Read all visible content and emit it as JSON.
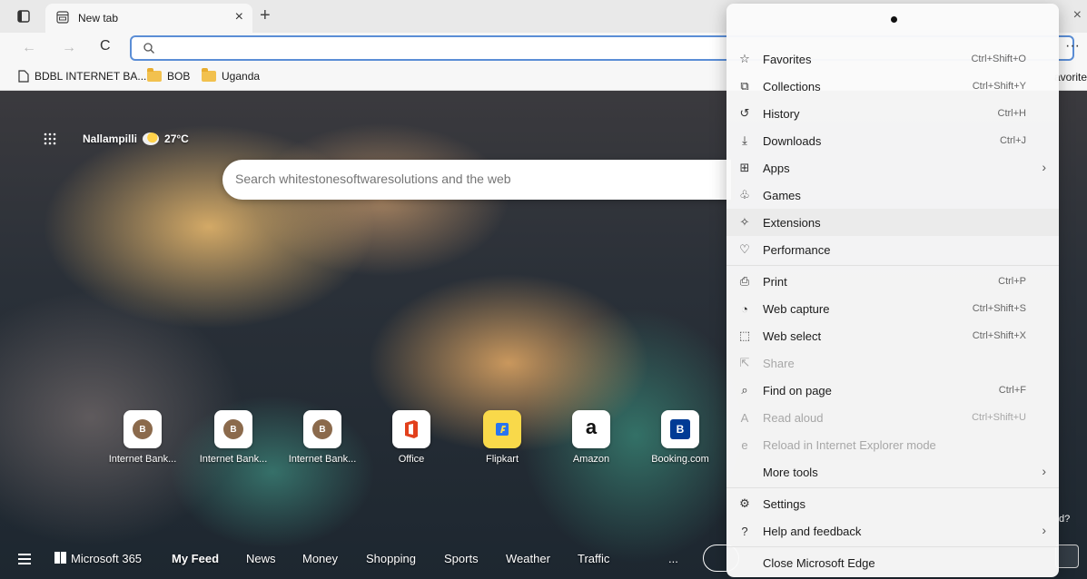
{
  "tab": {
    "title": "New tab",
    "close_glyph": "×"
  },
  "toolbar": {
    "address_value": "",
    "more_glyph": "···",
    "refresh_glyph": "C"
  },
  "bookmarks": [
    {
      "label": "BDBL INTERNET BA..."
    },
    {
      "label": "BOB"
    },
    {
      "label": "Uganda"
    }
  ],
  "bookmarks_other": "avorite",
  "ntp": {
    "location": "Nallampilli",
    "temperature": "27°C",
    "search_placeholder": "Search whitestonesoftwaresolutions and the web",
    "tiles": [
      {
        "label": "Internet Bank...",
        "icon": "B"
      },
      {
        "label": "Internet Bank...",
        "icon": "B"
      },
      {
        "label": "Internet Bank...",
        "icon": "B"
      },
      {
        "label": "Office",
        "icon": "office-icon"
      },
      {
        "label": "Flipkart",
        "icon": "flipkart-icon"
      },
      {
        "label": "Amazon",
        "icon": "a"
      },
      {
        "label": "Booking.com",
        "icon": "B"
      }
    ],
    "feed": [
      "Microsoft 365",
      "My Feed",
      "News",
      "Money",
      "Shopping",
      "Sports",
      "Weather",
      "Traffic",
      "..."
    ],
    "side_help": "d?"
  },
  "menu": {
    "items": [
      {
        "label": "Favorites",
        "shortcut": "Ctrl+Shift+O",
        "icon": "favorites-icon"
      },
      {
        "label": "Collections",
        "shortcut": "Ctrl+Shift+Y",
        "icon": "collections-icon"
      },
      {
        "label": "History",
        "shortcut": "Ctrl+H",
        "icon": "history-icon"
      },
      {
        "label": "Downloads",
        "shortcut": "Ctrl+J",
        "icon": "download-icon"
      },
      {
        "label": "Apps",
        "shortcut": "",
        "icon": "apps-icon",
        "submenu": true
      },
      {
        "label": "Games",
        "shortcut": "",
        "icon": "games-icon"
      },
      {
        "label": "Extensions",
        "shortcut": "",
        "icon": "extensions-icon",
        "hover": true
      },
      {
        "label": "Performance",
        "shortcut": "",
        "icon": "performance-icon"
      },
      {
        "label": "Print",
        "shortcut": "Ctrl+P",
        "icon": "print-icon"
      },
      {
        "label": "Web capture",
        "shortcut": "Ctrl+Shift+S",
        "icon": "web-capture-icon"
      },
      {
        "label": "Web select",
        "shortcut": "Ctrl+Shift+X",
        "icon": "web-select-icon"
      },
      {
        "label": "Share",
        "shortcut": "",
        "icon": "share-icon",
        "disabled": true
      },
      {
        "label": "Find on page",
        "shortcut": "Ctrl+F",
        "icon": "find-icon"
      },
      {
        "label": "Read aloud",
        "shortcut": "Ctrl+Shift+U",
        "icon": "read-aloud-icon",
        "disabled": true
      },
      {
        "label": "Reload in Internet Explorer mode",
        "shortcut": "",
        "icon": "ie-mode-icon",
        "disabled": true
      },
      {
        "label": "More tools",
        "shortcut": "",
        "icon": "",
        "submenu": true
      },
      {
        "label": "Settings",
        "shortcut": "",
        "icon": "settings-icon"
      },
      {
        "label": "Help and feedback",
        "shortcut": "",
        "icon": "help-icon",
        "submenu": true
      },
      {
        "label": "Close Microsoft Edge",
        "shortcut": "",
        "icon": ""
      }
    ],
    "submenu_glyph": "›"
  }
}
